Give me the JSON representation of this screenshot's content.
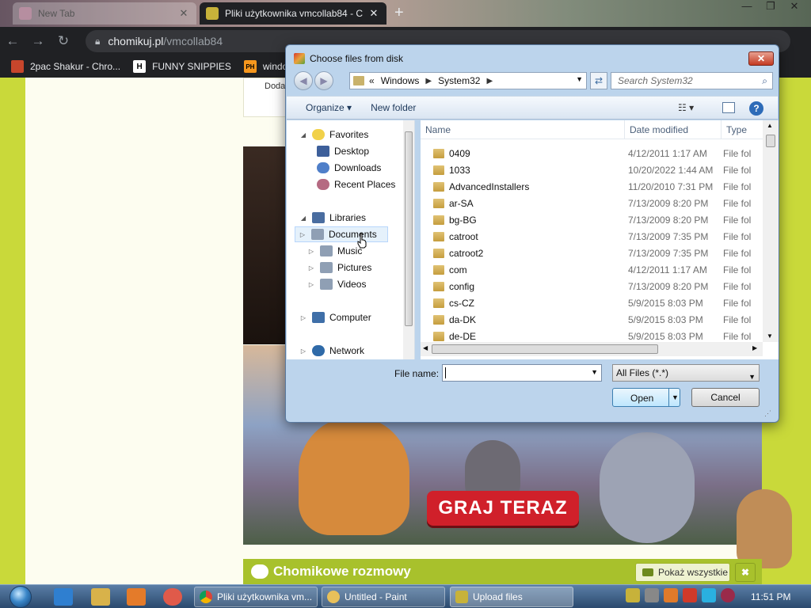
{
  "browser": {
    "tabs": [
      {
        "title": "New Tab",
        "active": false
      },
      {
        "title": "Pliki użytkownika vmcollab84 - C",
        "active": true
      }
    ],
    "url_domain": "chomikuj.pl",
    "url_path": "/vmcollab84",
    "bookmarks": [
      {
        "label": "2pac Shakur - Chro...",
        "icon_color": "#c7462c"
      },
      {
        "label": "FUNNY SNIPPIES",
        "icon_text": "H"
      },
      {
        "label": "window",
        "icon_text": "PH"
      }
    ]
  },
  "page": {
    "card_text": "Doda",
    "banner_cta": "GRAJ TERAZ",
    "section_title": "Chomikowe rozmowy",
    "show_all": "Pokaż wszystkie",
    "close": "✖"
  },
  "dialog": {
    "title": "Choose files from disk",
    "close_label": "✕",
    "breadcrumb": {
      "prefix": "«",
      "parts": [
        "Windows",
        "System32"
      ]
    },
    "search_placeholder": "Search System32",
    "commands": {
      "organize": "Organize ▾",
      "new_folder": "New folder"
    },
    "nav": {
      "favorites": "Favorites",
      "desktop": "Desktop",
      "downloads": "Downloads",
      "recent": "Recent Places",
      "libraries": "Libraries",
      "documents": "Documents",
      "music": "Music",
      "pictures": "Pictures",
      "videos": "Videos",
      "computer": "Computer",
      "network": "Network"
    },
    "columns": {
      "name": "Name",
      "date": "Date modified",
      "type": "Type"
    },
    "files": [
      {
        "name": "0409",
        "date": "4/12/2011 1:17 AM",
        "type": "File fol"
      },
      {
        "name": "1033",
        "date": "10/20/2022 1:44 AM",
        "type": "File fol"
      },
      {
        "name": "AdvancedInstallers",
        "date": "11/20/2010 7:31 PM",
        "type": "File fol"
      },
      {
        "name": "ar-SA",
        "date": "7/13/2009 8:20 PM",
        "type": "File fol"
      },
      {
        "name": "bg-BG",
        "date": "7/13/2009 8:20 PM",
        "type": "File fol"
      },
      {
        "name": "catroot",
        "date": "7/13/2009 7:35 PM",
        "type": "File fol"
      },
      {
        "name": "catroot2",
        "date": "7/13/2009 7:35 PM",
        "type": "File fol"
      },
      {
        "name": "com",
        "date": "4/12/2011 1:17 AM",
        "type": "File fol"
      },
      {
        "name": "config",
        "date": "7/13/2009 8:20 PM",
        "type": "File fol"
      },
      {
        "name": "cs-CZ",
        "date": "5/9/2015 8:03 PM",
        "type": "File fol"
      },
      {
        "name": "da-DK",
        "date": "5/9/2015 8:03 PM",
        "type": "File fol"
      },
      {
        "name": "de-DE",
        "date": "5/9/2015 8:03 PM",
        "type": "File fol"
      }
    ],
    "file_name_label": "File name:",
    "file_name_value": "",
    "filter": "All Files (*.*)",
    "open": "Open",
    "cancel": "Cancel"
  },
  "taskbar": {
    "buttons": [
      {
        "label": "Pliki użytkownika vm..."
      },
      {
        "label": "Untitled - Paint"
      },
      {
        "label": "Upload files"
      }
    ],
    "clock": "11:51 PM"
  }
}
